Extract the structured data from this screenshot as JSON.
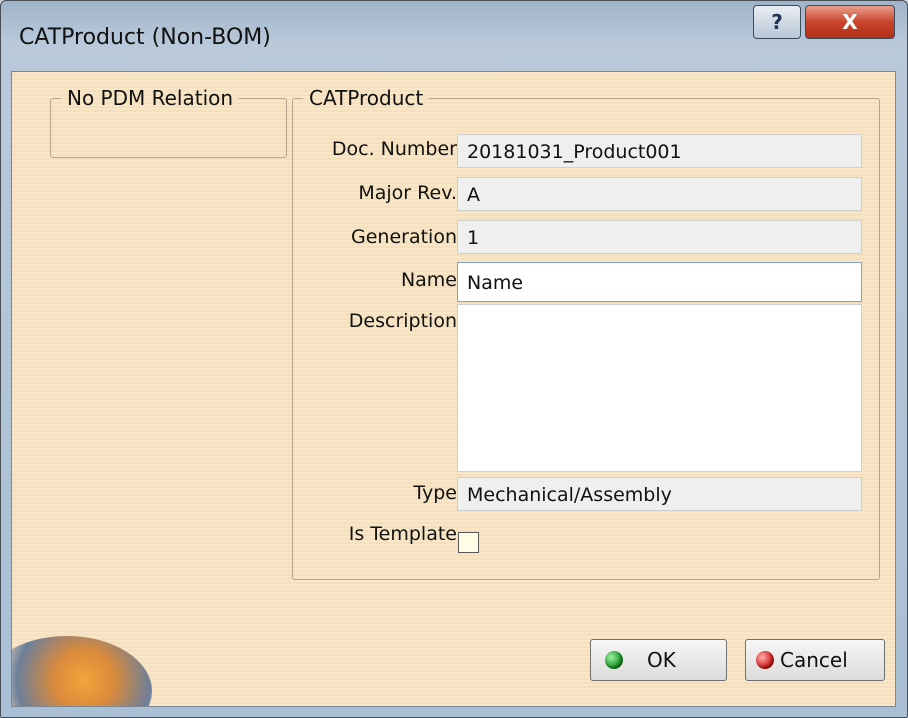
{
  "window": {
    "title": "CATProduct (Non-BOM)",
    "help_glyph": "?",
    "close_glyph": "X"
  },
  "pdm_group": {
    "legend": "No PDM Relation"
  },
  "product_group": {
    "legend": "CATProduct",
    "doc_number": {
      "label": "Doc. Number",
      "value": "20181031_Product001"
    },
    "major_rev": {
      "label": "Major Rev.",
      "value": "A"
    },
    "generation": {
      "label": "Generation",
      "value": "1"
    },
    "name": {
      "label": "Name",
      "value": "Name"
    },
    "description": {
      "label": "Description",
      "value": ""
    },
    "type": {
      "label": "Type",
      "value": "Mechanical/Assembly"
    },
    "is_template": {
      "label": "Is Template",
      "checked": false
    }
  },
  "buttons": {
    "ok": "OK",
    "cancel": "Cancel"
  },
  "colors": {
    "dialog_bg": "#f8e4c2",
    "title_bar": "#a9bfd6",
    "close_button": "#c9442b",
    "ok_icon": "#1e9b2c",
    "cancel_icon": "#d82222"
  }
}
